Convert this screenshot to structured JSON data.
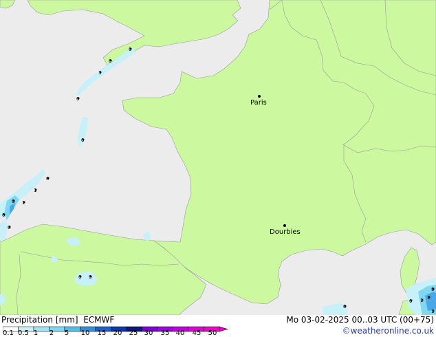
{
  "map": {
    "cities": [
      {
        "name": "Paris"
      },
      {
        "name": "Dourbies"
      }
    ],
    "precip_labels": [
      "0",
      "1",
      "0",
      "0",
      "0",
      "0",
      "1",
      "0",
      "1",
      "0",
      "0",
      "0",
      "0",
      "0",
      "0",
      "1",
      "1",
      "8",
      "1"
    ],
    "colors": {
      "land": "#ccf8a0",
      "sea": "#ececec",
      "border": "#9a9a9a",
      "precip_light": "#c8f0f8",
      "precip_mid": "#80d8f0",
      "precip_blue": "#4aa8e8"
    }
  },
  "legend": {
    "title": "Precipitation [mm]",
    "model": "ECMWF",
    "date": "Mo 03-02-2025 00..03 UTC (00+75)",
    "credit": "©weatheronline.co.uk",
    "ticks": [
      "0.1",
      "0.5",
      "1",
      "2",
      "5",
      "10",
      "15",
      "20",
      "25",
      "30",
      "35",
      "40",
      "45",
      "50"
    ],
    "colors": [
      "#ffffff",
      "#c8f0f8",
      "#a0e4f4",
      "#80d8f0",
      "#50c0e8",
      "#3090e0",
      "#1860d0",
      "#0838b0",
      "#081880",
      "#8000e0",
      "#a000e8",
      "#c000e0",
      "#e000d8",
      "#f000c8"
    ]
  }
}
